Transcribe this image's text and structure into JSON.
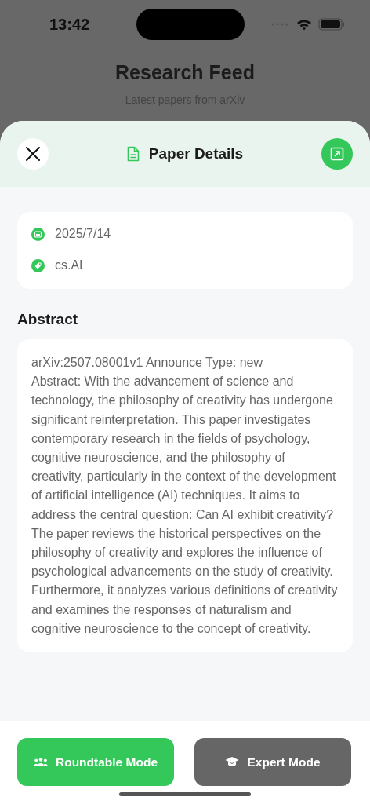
{
  "status_bar": {
    "time": "13:42"
  },
  "background_page": {
    "title": "Research Feed",
    "subtitle": "Latest papers from arXiv"
  },
  "sheet": {
    "title": "Paper Details",
    "meta": [
      {
        "kind": "date",
        "text": "2025/7/14"
      },
      {
        "kind": "category",
        "text": "cs.AI"
      }
    ],
    "abstract_heading": "Abstract",
    "abstract": "arXiv:2507.08001v1 Announce Type: new\nAbstract: With the advancement of science and technology, the philosophy of creativity has undergone significant reinterpretation. This paper investigates contemporary research in the fields of psychology, cognitive neuroscience, and the philosophy of creativity, particularly in the context of the development of artificial intelligence (AI) techniques. It aims to address the central question: Can AI exhibit creativity? The paper reviews the historical perspectives on the philosophy of creativity and explores the influence of psychological advancements on the study of creativity. Furthermore, it analyzes various definitions of creativity and examines the responses of naturalism and cognitive neuroscience to the concept of creativity.",
    "buttons": [
      {
        "kind": "roundtable",
        "label": "Roundtable Mode"
      },
      {
        "kind": "expert",
        "label": "Expert Mode"
      }
    ]
  }
}
